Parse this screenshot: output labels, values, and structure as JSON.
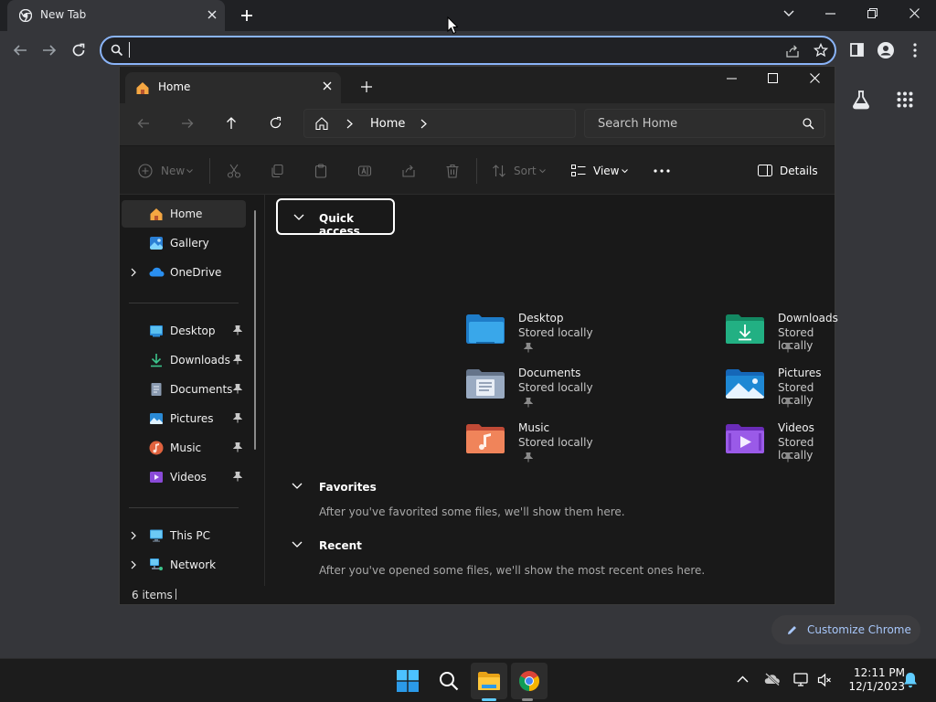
{
  "chrome": {
    "tab_title": "New Tab",
    "omnibox_value": "",
    "customize_label": "Customize Chrome"
  },
  "explorer": {
    "tab_title": "Home",
    "breadcrumb": [
      "Home"
    ],
    "search_placeholder": "Search Home",
    "commands": {
      "new": "New",
      "sort": "Sort",
      "view": "View",
      "details": "Details"
    },
    "nav": {
      "top": [
        {
          "label": "Home",
          "icon": "home-icon"
        },
        {
          "label": "Gallery",
          "icon": "gallery-icon"
        },
        {
          "label": "OneDrive",
          "icon": "cloud-icon"
        }
      ],
      "pinned": [
        {
          "label": "Desktop",
          "icon": "desktop-folder-icon"
        },
        {
          "label": "Downloads",
          "icon": "download-icon"
        },
        {
          "label": "Documents",
          "icon": "documents-icon"
        },
        {
          "label": "Pictures",
          "icon": "pictures-icon"
        },
        {
          "label": "Music",
          "icon": "music-icon"
        },
        {
          "label": "Videos",
          "icon": "videos-icon"
        }
      ],
      "bottom": [
        {
          "label": "This PC",
          "icon": "computer-icon"
        },
        {
          "label": "Network",
          "icon": "network-icon"
        }
      ]
    },
    "sections": {
      "quick_access": "Quick access",
      "favorites": "Favorites",
      "favorites_empty": "After you've favorited some files, we'll show them here.",
      "recent": "Recent",
      "recent_empty": "After you've opened some files, we'll show the most recent ones here."
    },
    "quick_access_items": [
      {
        "name": "Desktop",
        "sub": "Stored locally",
        "color": "#1e90d6"
      },
      {
        "name": "Downloads",
        "sub": "Stored locally",
        "color": "#1aa37a"
      },
      {
        "name": "Documents",
        "sub": "Stored locally",
        "color": "#7a8ca3"
      },
      {
        "name": "Pictures",
        "sub": "Stored locally",
        "color": "#1e88d4"
      },
      {
        "name": "Music",
        "sub": "Stored locally",
        "color": "#e06a4a"
      },
      {
        "name": "Videos",
        "sub": "Stored locally",
        "color": "#8a4ad8"
      }
    ],
    "status": "6 items"
  },
  "taskbar": {
    "time": "12:11 PM",
    "date": "12/1/2023"
  }
}
